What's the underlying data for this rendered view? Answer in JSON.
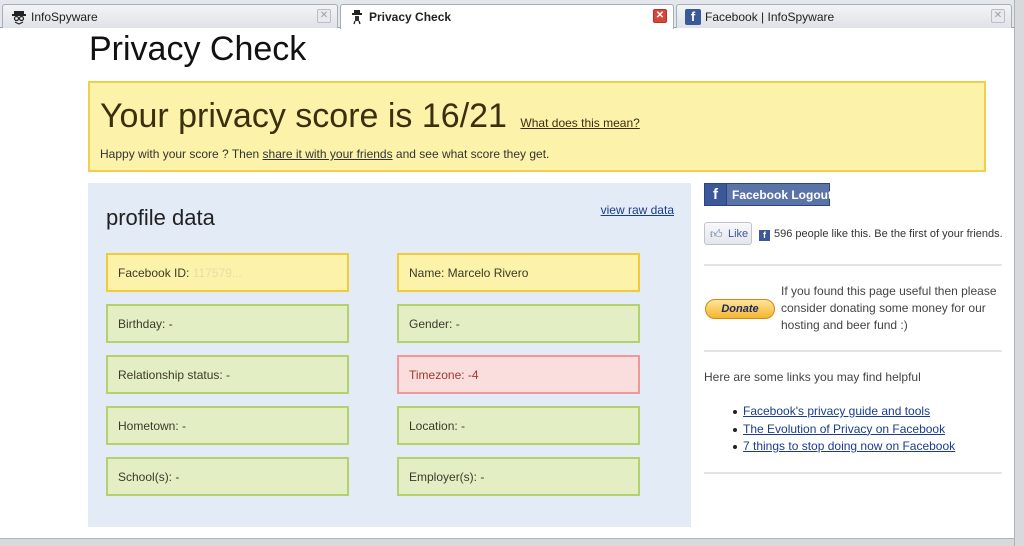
{
  "tabs": [
    {
      "label": "InfoSpyware",
      "icon": "spy-icon",
      "active": false
    },
    {
      "label": "Privacy Check",
      "icon": "spy-icon",
      "active": true
    },
    {
      "label": "Facebook | InfoSpyware",
      "icon": "facebook-icon",
      "active": false
    }
  ],
  "page": {
    "title": "Privacy Check"
  },
  "score": {
    "title": "Your privacy score is 16/21",
    "what_link": "What does this mean?",
    "sub_before": "Happy with your score ? Then ",
    "share_link": "share it with your friends",
    "sub_after": " and see what score they get."
  },
  "profile": {
    "title": "profile data",
    "raw_link": "view raw data",
    "fields": {
      "facebook_id_label": "Facebook ID:",
      "facebook_id_value": "117579...",
      "name": "Name: Marcelo Rivero",
      "birthday": "Birthday: -",
      "gender": "Gender: -",
      "relationship": "Relationship status: -",
      "timezone": "Timezone: -4",
      "hometown": "Hometown: -",
      "location": "Location: -",
      "schools": "School(s): -",
      "employers": "Employer(s): -"
    }
  },
  "sidebar": {
    "logout_label": "Facebook Logout",
    "like_label": "Like",
    "like_text": "596 people like this. Be the first of your friends.",
    "donate_label": "Donate",
    "donate_text": "If you found this page useful then please consider donating some money for our hosting and beer fund :)",
    "links_intro": "Here are some links you may find helpful",
    "links": [
      "Facebook's privacy guide and tools",
      "The Evolution of Privacy on Facebook",
      "7 things to stop doing now on Facebook"
    ]
  },
  "colors": {
    "facebook_blue": "#3b5998",
    "score_bg": "#fdf2a9",
    "panel_bg": "#e3ebf6",
    "field_green": "#e4eec4",
    "field_red": "#f9dedd"
  }
}
